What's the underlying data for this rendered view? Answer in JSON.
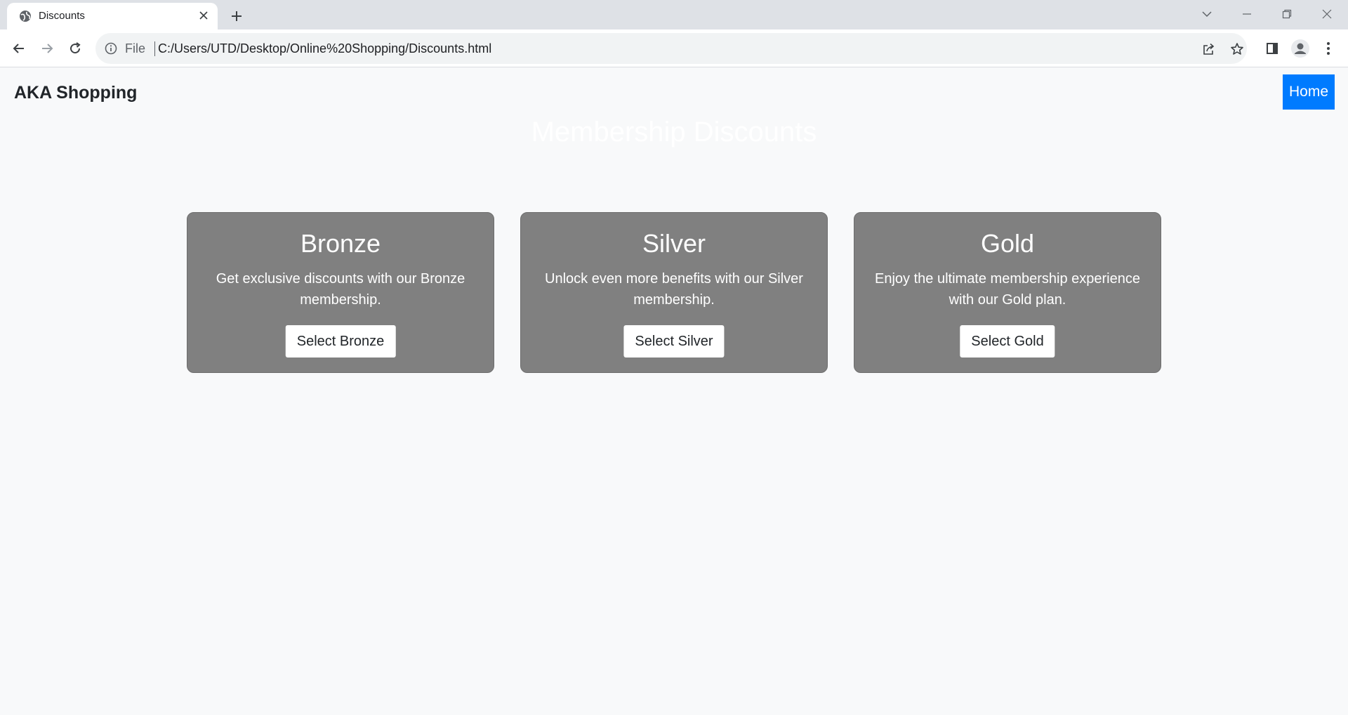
{
  "browser": {
    "tab_title": "Discounts",
    "file_label": "File",
    "url": "C:/Users/UTD/Desktop/Online%20Shopping/Discounts.html"
  },
  "nav": {
    "brand": "AKA Shopping",
    "home_label": "Home"
  },
  "page": {
    "title": "Membership Discounts"
  },
  "cards": [
    {
      "title": "Bronze",
      "description": "Get exclusive discounts with our Bronze membership.",
      "button": "Select Bronze"
    },
    {
      "title": "Silver",
      "description": "Unlock even more benefits with our Silver membership.",
      "button": "Select Silver"
    },
    {
      "title": "Gold",
      "description": "Enjoy the ultimate membership experience with our Gold plan.",
      "button": "Select Gold"
    }
  ],
  "colors": {
    "home_button": "#007bff",
    "card_background": "#808080",
    "page_background": "#f8f9fa"
  }
}
